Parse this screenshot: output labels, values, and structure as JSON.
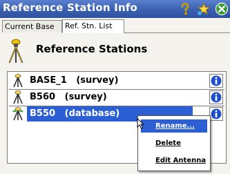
{
  "window": {
    "title": "Reference Station Info"
  },
  "tabs": [
    {
      "label": "Current Base"
    },
    {
      "label": "Ref. Stn. List"
    }
  ],
  "page": {
    "title": "Reference Stations"
  },
  "stations": [
    {
      "label": "BASE_1   (survey)"
    },
    {
      "label": "B560   (survey)"
    },
    {
      "label": "B550   (database)"
    }
  ],
  "context_menu": {
    "items": [
      {
        "label": "Rename..."
      },
      {
        "label": "Delete"
      },
      {
        "label": "Edit Antenna"
      }
    ]
  },
  "colors": {
    "titlebar": "#3a5fae",
    "selection": "#2d5fd4",
    "info_icon": "#1f4fc9",
    "close_button": "#2f9a2f"
  }
}
